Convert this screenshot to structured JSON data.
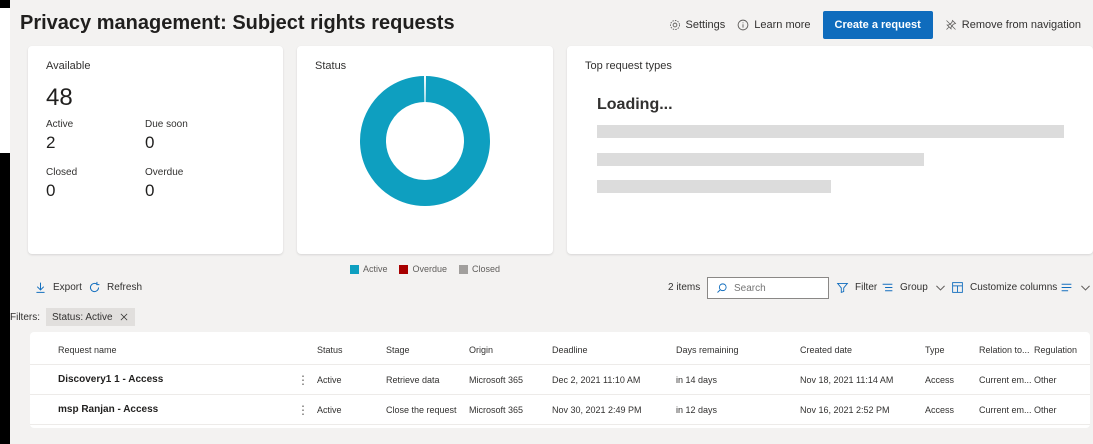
{
  "header": {
    "title": "Privacy management: Subject rights requests",
    "settings_label": "Settings",
    "learn_more_label": "Learn more",
    "create_label": "Create a request",
    "remove_nav_label": "Remove from navigation"
  },
  "available_card": {
    "title": "Available",
    "total": "48",
    "active_label": "Active",
    "active_value": "2",
    "due_soon_label": "Due soon",
    "due_soon_value": "0",
    "closed_label": "Closed",
    "closed_value": "0",
    "overdue_label": "Overdue",
    "overdue_value": "0"
  },
  "status_card": {
    "title": "Status",
    "legend": [
      "Active",
      "Overdue",
      "Closed"
    ],
    "colors": {
      "active": "#0e9fc0",
      "overdue": "#a80000",
      "closed": "#a19f9d"
    }
  },
  "chart_data": {
    "type": "pie",
    "categories": [
      "Active",
      "Overdue",
      "Closed"
    ],
    "values": [
      2,
      0,
      0
    ],
    "title": "Status"
  },
  "top_types_card": {
    "title": "Top request types",
    "loading_text": "Loading..."
  },
  "commandbar": {
    "export_label": "Export",
    "refresh_label": "Refresh",
    "items_count": "2 items",
    "search_placeholder": "Search",
    "filter_label": "Filter",
    "group_label": "Group",
    "customize_label": "Customize columns"
  },
  "filters": {
    "label": "Filters:",
    "chip": "Status: Active"
  },
  "table": {
    "columns": [
      "Request name",
      "Status",
      "Stage",
      "Origin",
      "Deadline",
      "Days remaining",
      "Created date",
      "Type",
      "Relation to...",
      "Regulation"
    ],
    "rows": [
      [
        "Discovery1 1 - Access",
        "Active",
        "Retrieve data",
        "Microsoft 365",
        "Dec 2, 2021 11:10 AM",
        "in 14 days",
        "Nov 18, 2021 11:14 AM",
        "Access",
        "Current em...",
        "Other"
      ],
      [
        "msp Ranjan - Access",
        "Active",
        "Close the request",
        "Microsoft 365",
        "Nov 30, 2021 2:49 PM",
        "in 12 days",
        "Nov 16, 2021 2:52 PM",
        "Access",
        "Current em...",
        "Other"
      ]
    ]
  }
}
